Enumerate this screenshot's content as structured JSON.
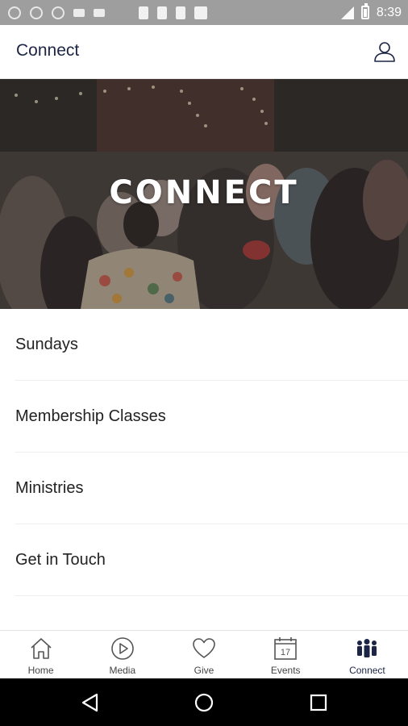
{
  "status_bar": {
    "time": "8:39",
    "left_icons": [
      "circle-notification-icon",
      "circle-notification-icon",
      "circle-notification-icon",
      "notification-icon",
      "notification-icon",
      "sim-icon",
      "sim-icon",
      "sd-card-icon",
      "n-icon"
    ],
    "right_icons": [
      "signal-icon",
      "battery-icon"
    ]
  },
  "header": {
    "title": "Connect",
    "profile_icon": "user-icon"
  },
  "hero": {
    "title": "CONNECT"
  },
  "menu": {
    "items": [
      {
        "label": "Sundays"
      },
      {
        "label": "Membership Classes"
      },
      {
        "label": "Ministries"
      },
      {
        "label": "Get in Touch"
      }
    ]
  },
  "tabs": {
    "items": [
      {
        "label": "Home",
        "icon": "home-icon"
      },
      {
        "label": "Media",
        "icon": "play-icon"
      },
      {
        "label": "Give",
        "icon": "heart-icon"
      },
      {
        "label": "Events",
        "icon": "calendar-icon",
        "calendar_day": "17"
      },
      {
        "label": "Connect",
        "icon": "people-icon",
        "active": true
      }
    ]
  },
  "colors": {
    "accent": "#1c2545",
    "status_bar": "#9e9e9e",
    "nav_bar": "#000000"
  }
}
